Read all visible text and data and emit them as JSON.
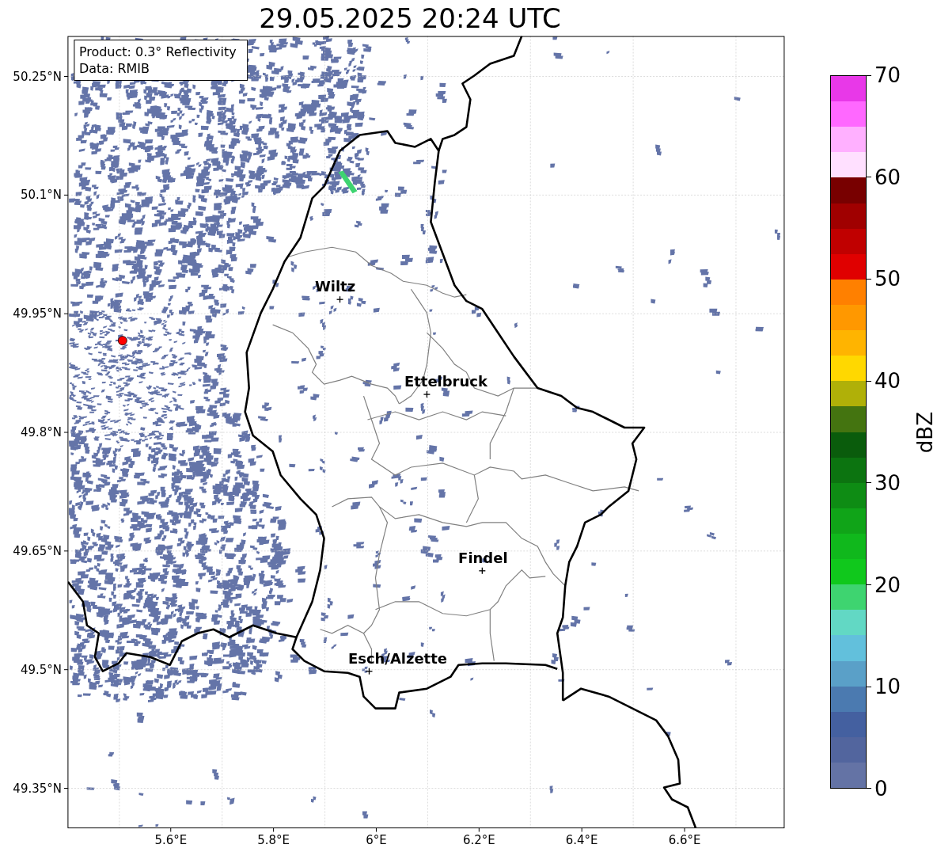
{
  "title": "29.05.2025 20:24 UTC",
  "info_box": {
    "lines": [
      "Product: 0.3° Reflectivity",
      "Data: RMIB"
    ]
  },
  "map": {
    "y_ticks": [
      "50.25°N",
      "50.1°N",
      "49.95°N",
      "49.8°N",
      "49.65°N",
      "49.5°N",
      "49.35°N"
    ],
    "x_ticks": [
      "5.6°E",
      "5.8°E",
      "6°E",
      "6.2°E",
      "6.4°E",
      "6.6°E"
    ],
    "cities": [
      {
        "name": "Wiltz"
      },
      {
        "name": "Ettelbruck"
      },
      {
        "name": "Findel"
      },
      {
        "name": "Esch/Alzette"
      }
    ]
  },
  "colorbar": {
    "label": "dBZ",
    "ticks": [
      "70",
      "60",
      "50",
      "40",
      "30",
      "20",
      "10",
      "0"
    ],
    "bands": [
      {
        "color": "#e838e8"
      },
      {
        "color": "#ff68ff"
      },
      {
        "color": "#ffb0ff"
      },
      {
        "color": "#ffe0ff"
      },
      {
        "color": "#780000"
      },
      {
        "color": "#a00000"
      },
      {
        "color": "#c00000"
      },
      {
        "color": "#e00000"
      },
      {
        "color": "#ff8000"
      },
      {
        "color": "#ff9800"
      },
      {
        "color": "#ffb400"
      },
      {
        "color": "#ffd800"
      },
      {
        "color": "#b0b008"
      },
      {
        "color": "#447410"
      },
      {
        "color": "#0a5c0c"
      },
      {
        "color": "#0c7410"
      },
      {
        "color": "#0e8c14"
      },
      {
        "color": "#10a418"
      },
      {
        "color": "#10b81c"
      },
      {
        "color": "#10c81c"
      },
      {
        "color": "#3ed470"
      },
      {
        "color": "#62d8c4"
      },
      {
        "color": "#62c0dc"
      },
      {
        "color": "#5aa0c8"
      },
      {
        "color": "#4b7ab0"
      },
      {
        "color": "#4460a0"
      },
      {
        "color": "#52659e"
      },
      {
        "color": "#6473a5"
      }
    ]
  }
}
